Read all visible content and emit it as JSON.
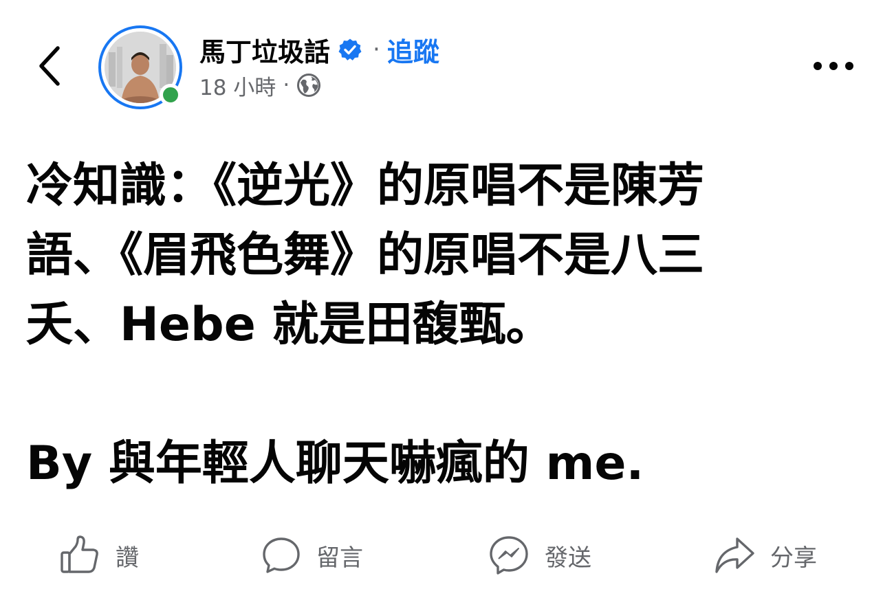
{
  "header": {
    "page_name": "馬丁垃圾話",
    "verified": true,
    "separator": "·",
    "follow_label": "追蹤",
    "timestamp": "18 小時",
    "meta_separator": "·",
    "audience_icon": "globe-icon",
    "back_icon": "chevron-left-icon",
    "more_icon": "more-horizontal-icon",
    "online_status": "online"
  },
  "post": {
    "lines": [
      "冷知識：《逆光》的原唱不是陳芳",
      "語、《眉飛色舞》的原唱不是八三",
      "夭、Hebe 就是田馥甄。"
    ],
    "signoff": "By 與年輕人聊天嚇瘋的 me."
  },
  "actions": {
    "like": {
      "label": "讚",
      "icon": "thumbs-up-icon"
    },
    "comment": {
      "label": "留言",
      "icon": "comment-bubble-icon"
    },
    "send": {
      "label": "發送",
      "icon": "messenger-icon"
    },
    "share": {
      "label": "分享",
      "icon": "share-arrow-icon"
    }
  },
  "colors": {
    "accent": "#1877f2",
    "text": "#050505",
    "secondary_text": "#65676b",
    "online": "#31a24c"
  }
}
